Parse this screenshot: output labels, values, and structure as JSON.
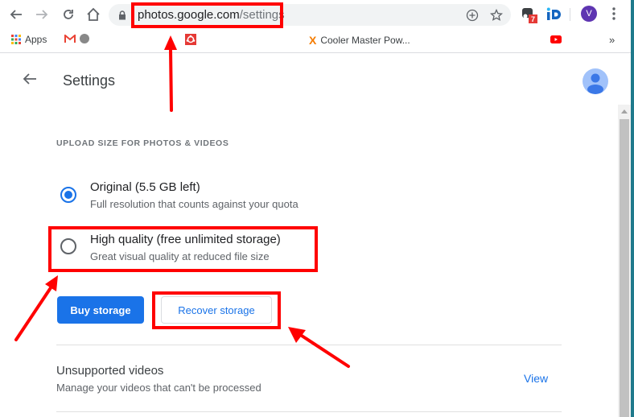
{
  "browser": {
    "url_host": "photos.google.com",
    "url_path": "/settings",
    "extension_badge": "7",
    "profile_initial": "V",
    "colors": {
      "profile": "#5e35b1",
      "badge": "#e53935",
      "accent": "#1a73e8"
    }
  },
  "bookmarks": {
    "items": [
      {
        "label": "Apps",
        "icon": "apps-grid-icon"
      },
      {
        "label": "",
        "icon": "gmail-icon",
        "redacted": true
      },
      {
        "label": "",
        "icon": "red-logo-icon",
        "redacted": true
      },
      {
        "label": "Cooler Master Pow...",
        "icon": "x-logo-icon"
      },
      {
        "label": "",
        "icon": "bookmark-icon",
        "redacted": true
      },
      {
        "label": "",
        "icon": "youtube-icon"
      }
    ],
    "overflow": "»"
  },
  "page": {
    "title": "Settings",
    "section_label": "UPLOAD SIZE FOR PHOTOS & VIDEOS",
    "options": [
      {
        "title": "Original (5.5 GB left)",
        "description": "Full resolution that counts against your quota",
        "selected": true
      },
      {
        "title": "High quality (free unlimited storage)",
        "description": "Great visual quality at reduced file size",
        "selected": false
      }
    ],
    "buttons": {
      "buy": "Buy storage",
      "recover": "Recover storage"
    },
    "unsupported": {
      "title": "Unsupported videos",
      "description": "Manage your videos that can't be processed",
      "link": "View"
    }
  }
}
